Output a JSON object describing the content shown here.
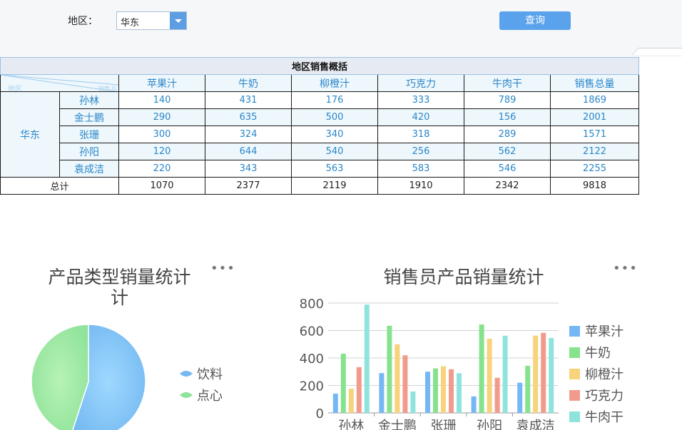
{
  "filter": {
    "region_label": "地区：",
    "region_value": "华东",
    "query_label": "查询"
  },
  "report": {
    "title": "地区销售概括",
    "corner_left": "地区",
    "corner_right": "销售品",
    "columns": [
      "苹果汁",
      "牛奶",
      "柳橙汁",
      "巧克力",
      "牛肉干",
      "销售总量"
    ],
    "region": "华东",
    "rows": [
      {
        "name": "孙林",
        "values": [
          "140",
          "431",
          "176",
          "333",
          "789",
          "1869"
        ]
      },
      {
        "name": "金士鹏",
        "values": [
          "290",
          "635",
          "500",
          "420",
          "156",
          "2001"
        ]
      },
      {
        "name": "张珊",
        "values": [
          "300",
          "324",
          "340",
          "318",
          "289",
          "1571"
        ]
      },
      {
        "name": "孙阳",
        "values": [
          "120",
          "644",
          "540",
          "256",
          "562",
          "2122"
        ]
      },
      {
        "name": "袁成洁",
        "values": [
          "220",
          "343",
          "563",
          "583",
          "546",
          "2255"
        ]
      }
    ],
    "total_label": "总计",
    "totals": [
      "1070",
      "2377",
      "2119",
      "1910",
      "2342",
      "9818"
    ]
  },
  "pie_menu": "•••",
  "bar_menu": "•••",
  "chart_data": [
    {
      "type": "pie",
      "title": "产品类型销量统计",
      "title_lines": [
        "产品类型销量统计",
        "计"
      ],
      "categories": [
        "饮料",
        "点心"
      ],
      "values": [
        55,
        45
      ],
      "colors": [
        "#74b9f1",
        "#8fe39a"
      ],
      "legend_position": "right"
    },
    {
      "type": "bar",
      "title": "销售员产品销量统计",
      "categories": [
        "孙林",
        "金士鹏",
        "张珊",
        "孙阳",
        "袁成洁"
      ],
      "series": [
        {
          "name": "苹果汁",
          "values": [
            140,
            290,
            300,
            120,
            220
          ],
          "color": "#75b7f5"
        },
        {
          "name": "牛奶",
          "values": [
            431,
            635,
            324,
            644,
            343
          ],
          "color": "#86e28d"
        },
        {
          "name": "柳橙汁",
          "values": [
            176,
            500,
            340,
            540,
            563
          ],
          "color": "#f7d37b"
        },
        {
          "name": "巧克力",
          "values": [
            333,
            420,
            318,
            256,
            583
          ],
          "color": "#f19b8c"
        },
        {
          "name": "牛肉干",
          "values": [
            789,
            156,
            289,
            562,
            546
          ],
          "color": "#8ee4dd"
        }
      ],
      "yticks": [
        "0",
        "200",
        "400",
        "600",
        "800"
      ],
      "ylim": [
        0,
        800
      ],
      "grid": true,
      "legend_position": "right"
    }
  ]
}
